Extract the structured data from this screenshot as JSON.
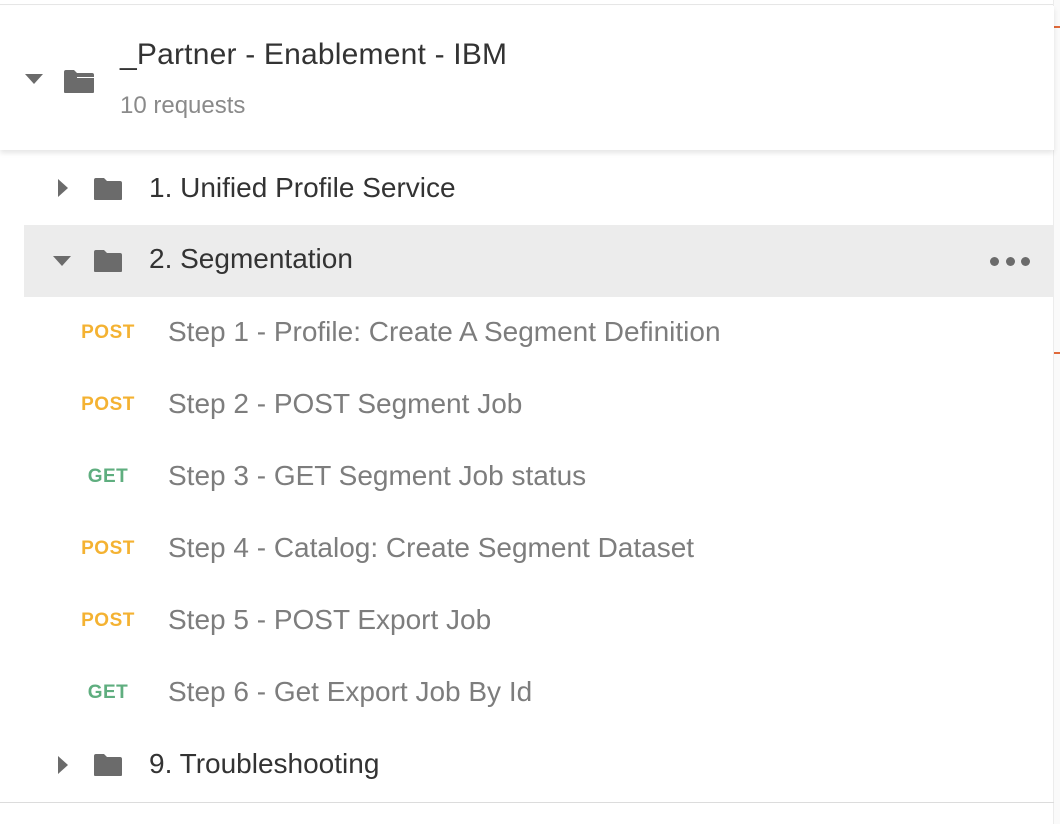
{
  "collection": {
    "name": "_Partner - Enablement - IBM",
    "subtitle": "10 requests",
    "icon": "folder-open-icon"
  },
  "folders": [
    {
      "label": "1. Unified Profile Service",
      "expanded": false,
      "icon": "folder-icon"
    },
    {
      "label": "2. Segmentation",
      "expanded": true,
      "selected": true,
      "icon": "folder-icon",
      "menu_icon": "more-horizontal-icon",
      "requests": [
        {
          "method": "POST",
          "label": "Step 1 - Profile: Create A Segment Definition"
        },
        {
          "method": "POST",
          "label": "Step 2 - POST Segment Job"
        },
        {
          "method": "GET",
          "label": "Step 3 - GET Segment Job status"
        },
        {
          "method": "POST",
          "label": "Step 4 - Catalog: Create Segment Dataset"
        },
        {
          "method": "POST",
          "label": "Step 5 - POST Export Job"
        },
        {
          "method": "GET",
          "label": "Step 6 - Get Export Job By Id"
        }
      ]
    },
    {
      "label": "9. Troubleshooting",
      "expanded": false,
      "icon": "folder-icon"
    }
  ],
  "colors": {
    "post": "#f4b232",
    "get": "#5fae7f",
    "selected_bg": "#ececec",
    "accent": "#e06a3b"
  }
}
